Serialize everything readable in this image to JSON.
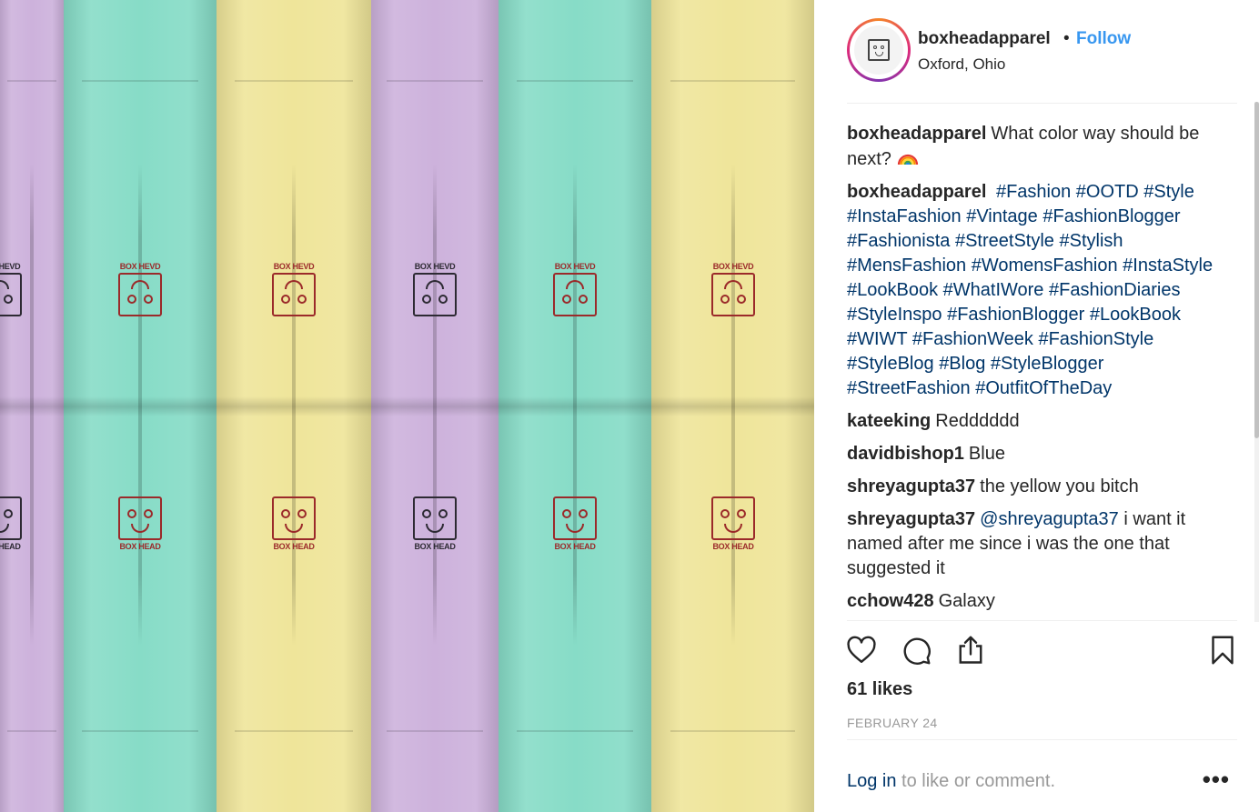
{
  "post": {
    "username": "boxheadapparel",
    "separator": "•",
    "follow_label": "Follow",
    "location": "Oxford, Ohio"
  },
  "photo": {
    "stripes": [
      "#cdb2dc",
      "#87dcc7",
      "#efe59a",
      "#cdb2dc",
      "#87dcc7",
      "#efe59a"
    ],
    "logo_top_text": "BOX HEVD",
    "logo_bottom_text": "BOX HEAD"
  },
  "caption": {
    "username": "boxheadapparel",
    "text": "What color way should be next?",
    "emoji": "rainbow-emoji"
  },
  "hashtag_comment": {
    "username": "boxheadapparel",
    "tags": [
      "#Fashion",
      "#OOTD",
      "#Style",
      "#InstaFashion",
      "#Vintage",
      "#FashionBlogger",
      "#Fashionista",
      "#StreetStyle",
      "#Stylish",
      "#MensFashion",
      "#WomensFashion",
      "#InstaStyle",
      "#LookBook",
      "#WhatIWore",
      "#FashionDiaries",
      "#StyleInspo",
      "#FashionBlogger",
      "#LookBook",
      "#WIWT",
      "#FashionWeek",
      "#FashionStyle",
      "#StyleBlog",
      "#Blog",
      "#StyleBlogger",
      "#StreetFashion",
      "#OutfitOfTheDay"
    ]
  },
  "comments": [
    {
      "username": "kateeking",
      "text": "Redddddd"
    },
    {
      "username": "davidbishop1",
      "text": "Blue"
    },
    {
      "username": "shreyagupta37",
      "text": "the yellow you bitch"
    },
    {
      "username": "shreyagupta37",
      "mention": "@shreyagupta37",
      "text": "i want it named after me since i was the one that suggested it"
    },
    {
      "username": "cchow428",
      "text": "Galaxy"
    }
  ],
  "actions": {
    "like_icon": "heart-icon",
    "comment_icon": "comment-icon",
    "share_icon": "share-icon",
    "save_icon": "bookmark-icon",
    "likes": "61 likes",
    "date": "FEBRUARY 24"
  },
  "footer": {
    "login_link": "Log in",
    "login_text": " to like or comment.",
    "more": "•••"
  },
  "colors": {
    "link": "#003569",
    "follow": "#3897f0",
    "logo_red": "#9b2a2a",
    "logo_dark": "#2d2a33"
  }
}
